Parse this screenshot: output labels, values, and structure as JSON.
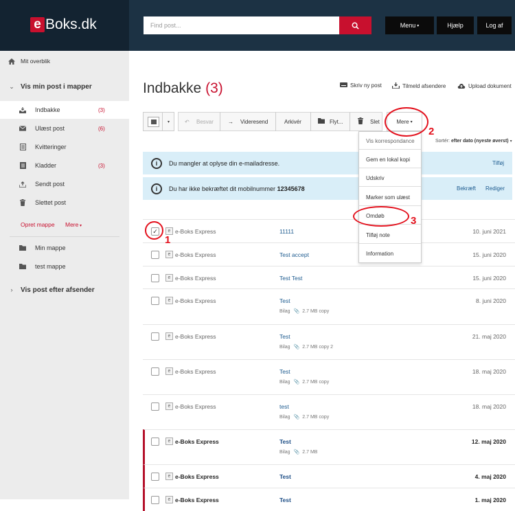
{
  "brand": {
    "e": "e",
    "name": "Boks.dk"
  },
  "search": {
    "placeholder": "Find post..."
  },
  "top_buttons": {
    "menu": "Menu",
    "help": "Hjælp",
    "logout": "Log af"
  },
  "sidebar": {
    "overview": "Mit overblik",
    "folders_header": "Vis min post i mapper",
    "items": [
      {
        "label": "Indbakke",
        "count": "(3)"
      },
      {
        "label": "Ulæst post",
        "count": "(6)"
      },
      {
        "label": "Kvitteringer",
        "count": ""
      },
      {
        "label": "Kladder",
        "count": "(3)"
      },
      {
        "label": "Sendt post",
        "count": ""
      },
      {
        "label": "Slettet post",
        "count": ""
      }
    ],
    "create_folder": "Opret mappe",
    "more": "Mere",
    "folders": [
      "Min mappe",
      "test mappe"
    ],
    "by_sender": "Vis post efter afsender"
  },
  "main": {
    "title": "Indbakke",
    "title_count": "(3)",
    "links": {
      "write": "Skriv ny post",
      "subscribe": "Tilmeld afsendere",
      "upload": "Upload dokument"
    }
  },
  "toolbar": {
    "reply": "Besvar",
    "forward": "Videresend",
    "archive": "Arkivér",
    "move": "Flyt...",
    "delete": "Slet",
    "more": "Mere"
  },
  "sort": {
    "label": "Sortér:",
    "value": "efter dato (nyeste øverst)"
  },
  "banners": [
    {
      "text": "Du mangler at oplyse din e-mailadresse.",
      "link1": "Tilføj"
    },
    {
      "text_prefix": "Du har ikke bekræftet dit mobilnummer ",
      "number": "12345678",
      "link1": "Bekræft",
      "link2": "Rediger"
    }
  ],
  "dropdown": [
    "Vis korrespondance",
    "Gem en lokal kopi",
    "Udskriv",
    "Marker som ulæst",
    "Omdøb",
    "Tilføj note",
    "Information"
  ],
  "messages": [
    {
      "sender": "e-Boks Express",
      "subject": "11111",
      "date": "10. juni 2021",
      "bilag": "",
      "size": "",
      "file": ""
    },
    {
      "sender": "e-Boks Express",
      "subject": "Test accept",
      "date": "15. juni 2020",
      "bilag": "",
      "size": "",
      "file": ""
    },
    {
      "sender": "e-Boks Express",
      "subject": "Test Test",
      "date": "15. juni 2020",
      "bilag": "",
      "size": "",
      "file": ""
    },
    {
      "sender": "e-Boks Express",
      "subject": "Test",
      "date": "8. juni 2020",
      "bilag": "Bilag",
      "size": "2.7 MB",
      "file": "copy"
    },
    {
      "sender": "e-Boks Express",
      "subject": "Test",
      "date": "21. maj 2020",
      "bilag": "Bilag",
      "size": "2.7 MB",
      "file": "copy 2"
    },
    {
      "sender": "e-Boks Express",
      "subject": "Test",
      "date": "18. maj 2020",
      "bilag": "Bilag",
      "size": "2.7 MB",
      "file": "copy"
    },
    {
      "sender": "e-Boks Express",
      "subject": "test",
      "date": "18. maj 2020",
      "bilag": "Bilag",
      "size": "2.7 MB",
      "file": "copy"
    },
    {
      "sender": "e-Boks Express",
      "subject": "Test",
      "date": "12. maj 2020",
      "bilag": "Bilag",
      "size": "2.7 MB",
      "file": ""
    },
    {
      "sender": "e-Boks Express",
      "subject": "Test",
      "date": "4. maj 2020",
      "bilag": "",
      "size": "",
      "file": ""
    },
    {
      "sender": "e-Boks Express",
      "subject": "Test",
      "date": "1. maj 2020",
      "bilag": "",
      "size": "",
      "file": ""
    }
  ],
  "annotations": [
    "1",
    "2",
    "3"
  ],
  "colors": {
    "brand_red": "#c8102e",
    "header_bg": "#1c3244",
    "annotation_red": "#e3101c",
    "info_bg": "#d9eef8"
  }
}
